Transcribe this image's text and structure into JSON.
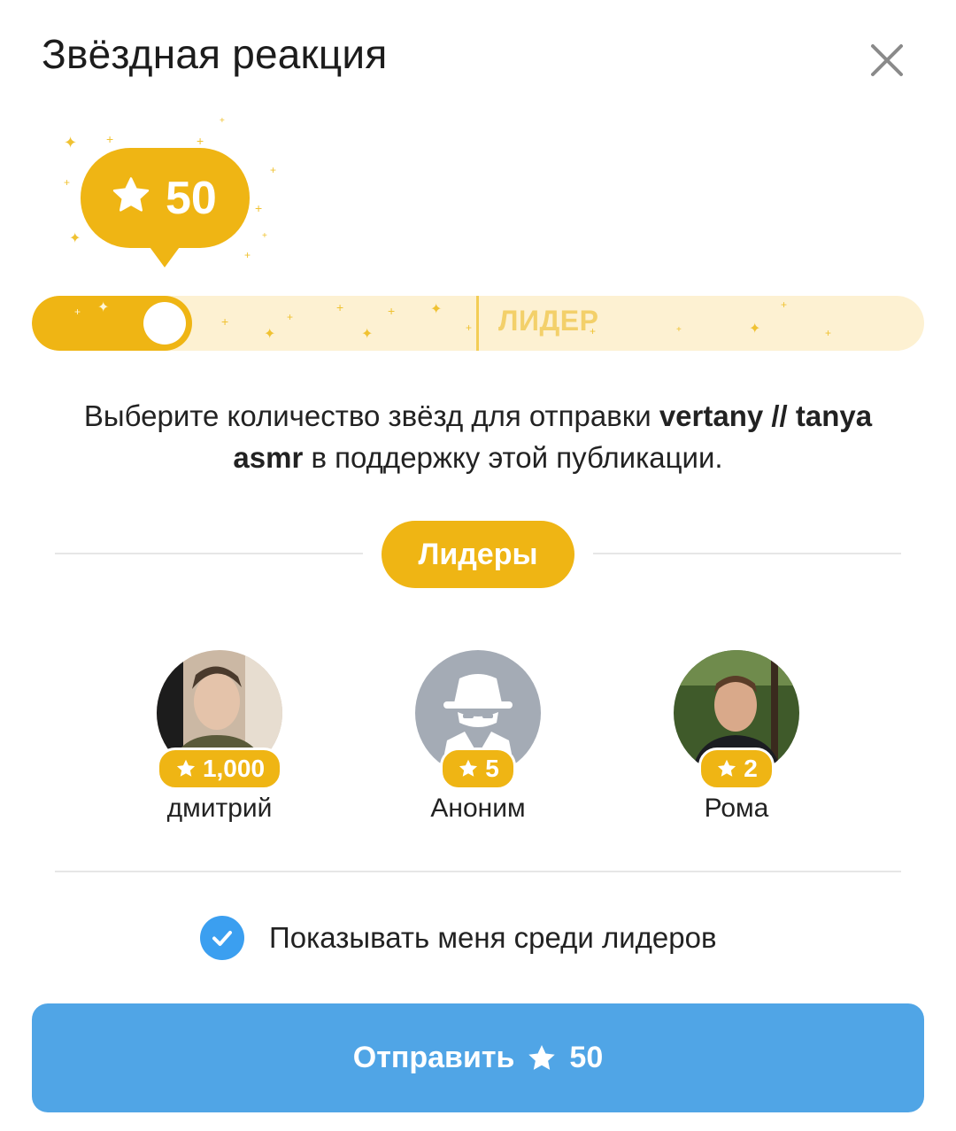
{
  "dialog": {
    "title": "Звёздная реакция"
  },
  "reaction": {
    "amount": "50",
    "slider_fraction": 0.17,
    "leader_mark_label": "ЛИДЕР"
  },
  "description": {
    "before": "Выберите количество звёзд для отправки ",
    "channel_name": "vertany // tanya asmr",
    "after": " в поддержку этой публикации."
  },
  "leaders": {
    "section_label": "Лидеры",
    "items": [
      {
        "name": "дмитрий",
        "stars": "1,000",
        "avatar": "photo"
      },
      {
        "name": "Аноним",
        "stars": "5",
        "avatar": "anonymous-icon"
      },
      {
        "name": "Рома",
        "stars": "2",
        "avatar": "photo"
      }
    ]
  },
  "show_in_leaders": {
    "label": "Показывать меня среди лидеров",
    "checked": true
  },
  "send_button": {
    "label": "Отправить",
    "amount": "50"
  },
  "colors": {
    "gold": "#efb514",
    "gold_light": "#fdf1d2",
    "blue": "#50a5e6",
    "check_blue": "#3b9ff0"
  }
}
